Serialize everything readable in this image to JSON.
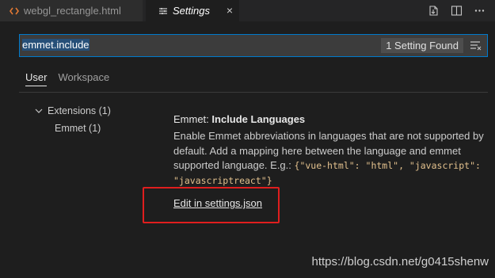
{
  "tabs": [
    {
      "label": "webgl_rectangle.html",
      "icon": "code-brackets-icon",
      "active": false
    },
    {
      "label": "Settings",
      "icon": "settings-list-icon",
      "active": true,
      "close": "×"
    }
  ],
  "search": {
    "value": "emmet.include",
    "result_count": "1 Setting Found"
  },
  "scope_tabs": [
    "User",
    "Workspace"
  ],
  "toc": {
    "group": "Extensions (1)",
    "item": "Emmet (1)"
  },
  "setting": {
    "category": "Emmet: ",
    "name": "Include Languages",
    "description_text": "Enable Emmet abbreviations in languages that are not supported by default. Add a mapping here between the language and emmet supported language. E.g.: ",
    "description_code": "{\"vue-html\": \"html\", \"javascript\": \"javascriptreact\"}",
    "edit_link": "Edit in settings.json"
  },
  "watermark": "https://blog.csdn.net/g0415shenw",
  "colors": {
    "accent": "#007acc",
    "highlight_box": "#e01e1e",
    "code": "#e2c08d",
    "html_icon": "#e37933"
  }
}
